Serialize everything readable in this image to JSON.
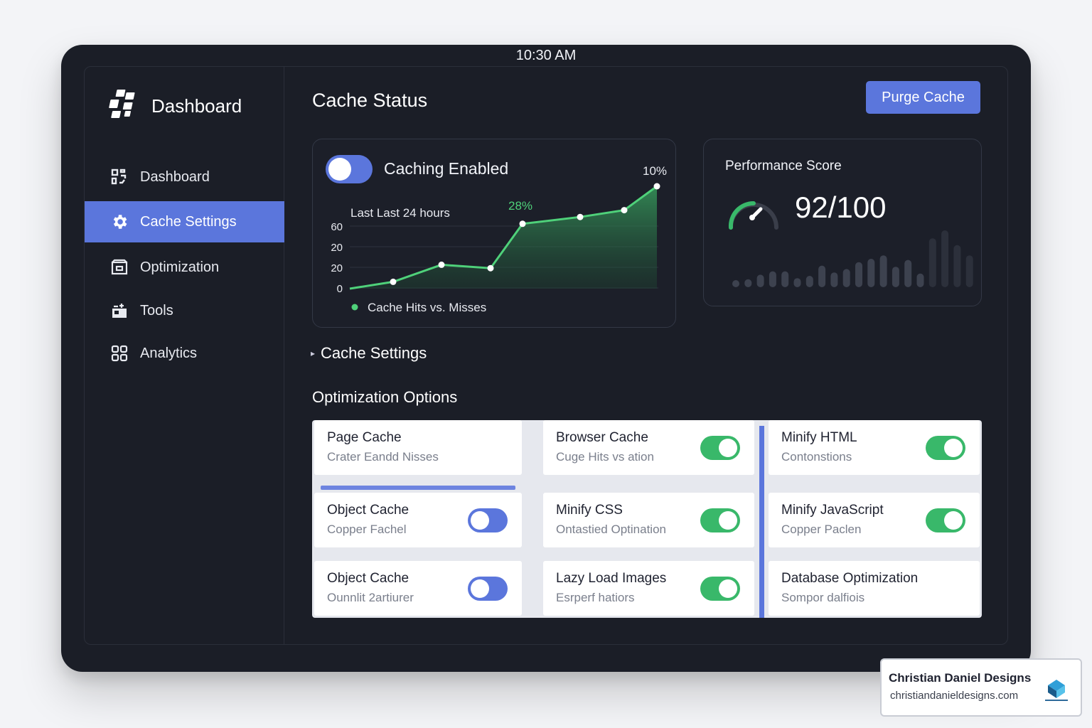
{
  "status_bar": {
    "time": "10:30 AM"
  },
  "sidebar": {
    "brand": "Dashboard",
    "items": [
      {
        "label": "Dashboard",
        "icon": "dashboard-icon",
        "active": false
      },
      {
        "label": "Cache Settings",
        "icon": "gear-icon",
        "active": true
      },
      {
        "label": "Optimization",
        "icon": "optimization-icon",
        "active": false
      },
      {
        "label": "Tools",
        "icon": "tools-icon",
        "active": false
      },
      {
        "label": "Analytics",
        "icon": "grid-icon",
        "active": false
      }
    ]
  },
  "header": {
    "title": "Cache Status",
    "purge_label": "Purge Cache"
  },
  "caching": {
    "label": "Caching Enabled",
    "enabled": true
  },
  "chart_data": {
    "type": "area",
    "title": "Last Last 24 hours",
    "legend": "Cache Hits vs. Misses",
    "y_tick_labels": [
      "60",
      "20",
      "20",
      "0"
    ],
    "x": [
      0,
      1,
      2,
      3,
      4,
      5,
      6,
      7
    ],
    "values": [
      0,
      2,
      7,
      6,
      19,
      21,
      23,
      30
    ],
    "annotations": [
      {
        "text": "28%",
        "index": 4
      },
      {
        "text": "10%",
        "index": 7
      }
    ],
    "grid": true,
    "color": "#4fd17a"
  },
  "performance": {
    "title": "Performance Score",
    "score": "92/100",
    "score_value": 92,
    "bar_levels": [
      0.12,
      0.14,
      0.22,
      0.28,
      0.28,
      0.16,
      0.2,
      0.38,
      0.26,
      0.32,
      0.44,
      0.5,
      0.56,
      0.36,
      0.48,
      0.24,
      0.86,
      1.0,
      0.74,
      0.56
    ]
  },
  "sections": {
    "cache_settings": "Cache Settings",
    "optimization_options": "Optimization Options"
  },
  "options": [
    {
      "title": "Page Cache",
      "subtitle": "Crater Eandd Nisses",
      "toggle": null
    },
    {
      "title": "Browser Cache",
      "subtitle": "Cuge Hits vs ation",
      "toggle": "green"
    },
    {
      "title": "Minify HTML",
      "subtitle": "Contonstions",
      "toggle": "green"
    },
    {
      "title": "Object Cache",
      "subtitle": "Copper Fachel",
      "toggle": "blue"
    },
    {
      "title": "Minify CSS",
      "subtitle": "Ontastied Optination",
      "toggle": "green"
    },
    {
      "title": "Minify JavaScript",
      "subtitle": "Copper Paclen",
      "toggle": "green"
    },
    {
      "title": "Object Cache",
      "subtitle": "Ounnlit 2artiurer",
      "toggle": "blue"
    },
    {
      "title": "Lazy Load Images",
      "subtitle": "Esrperf hatiors",
      "toggle": "green"
    },
    {
      "title": "Database Optimization",
      "subtitle": "Sompor dalfiois",
      "toggle": null
    }
  ],
  "watermark": {
    "name": "Christian Daniel Designs",
    "url": "christiandanieldesigns.com"
  },
  "colors": {
    "accent": "#5b76dc",
    "success": "#39b86a",
    "background": "#1b1e27"
  }
}
